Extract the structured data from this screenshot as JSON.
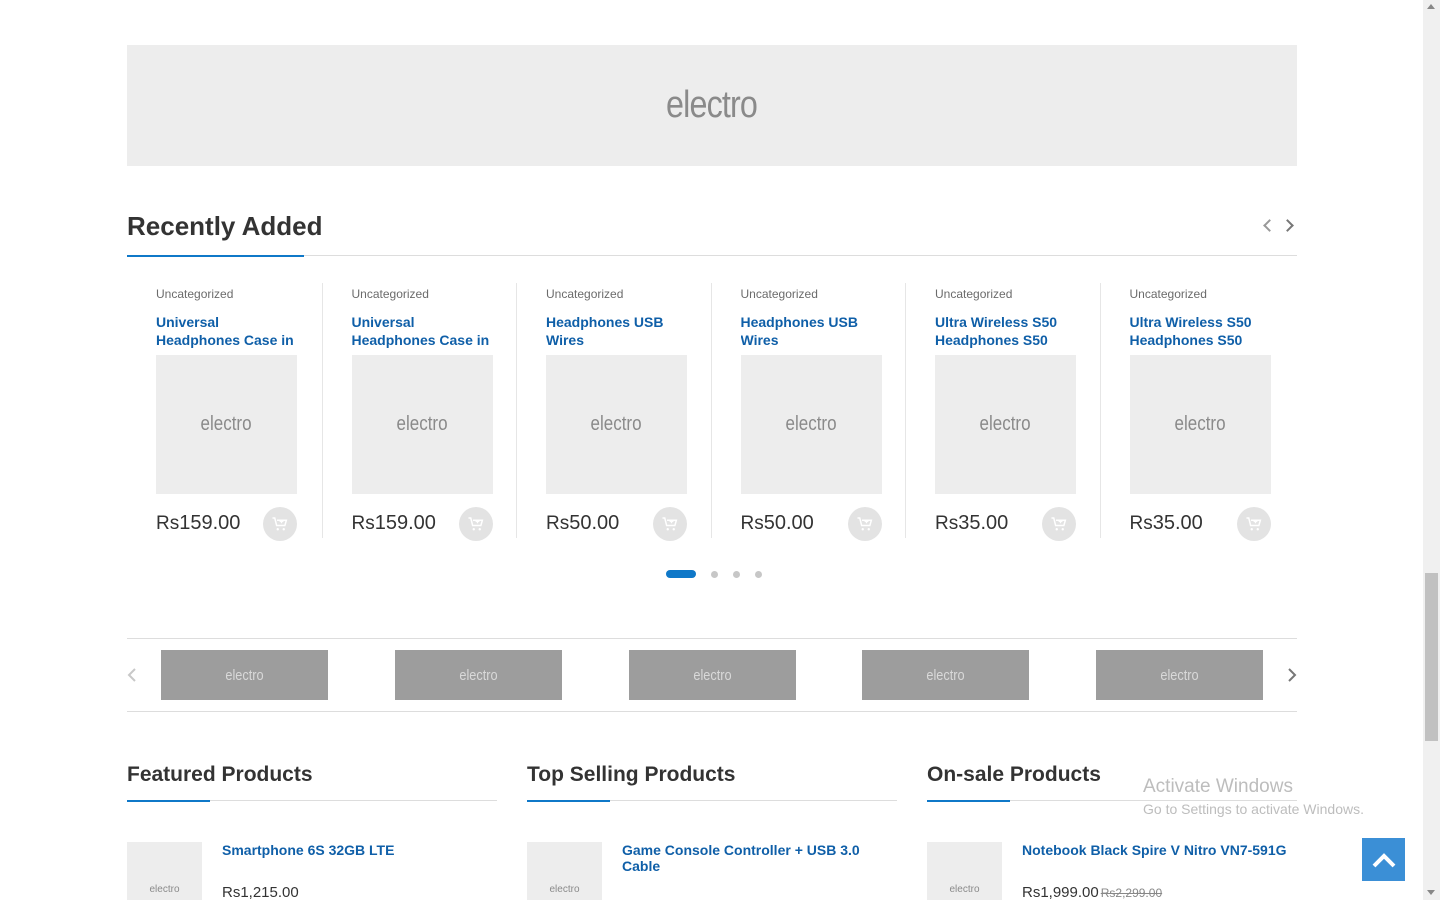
{
  "banner": {
    "logo": "electro"
  },
  "recently_added": {
    "title": "Recently Added",
    "products": [
      {
        "category": "Uncategorized",
        "title": "Universal Headphones Case in",
        "image_text": "electro",
        "currency": "Rs",
        "price": "159.00"
      },
      {
        "category": "Uncategorized",
        "title": "Universal Headphones Case in",
        "image_text": "electro",
        "currency": "Rs",
        "price": "159.00"
      },
      {
        "category": "Uncategorized",
        "title": "Headphones USB Wires",
        "image_text": "electro",
        "currency": "Rs",
        "price": "50.00"
      },
      {
        "category": "Uncategorized",
        "title": "Headphones USB Wires",
        "image_text": "electro",
        "currency": "Rs",
        "price": "50.00"
      },
      {
        "category": "Uncategorized",
        "title": "Ultra Wireless S50 Headphones S50",
        "image_text": "electro",
        "currency": "Rs",
        "price": "35.00"
      },
      {
        "category": "Uncategorized",
        "title": "Ultra Wireless S50 Headphones S50",
        "image_text": "electro",
        "currency": "Rs",
        "price": "35.00"
      }
    ],
    "pagination": {
      "pages": 4,
      "active": 1
    }
  },
  "brands": [
    "electro",
    "electro",
    "electro",
    "electro",
    "electro"
  ],
  "columns": [
    {
      "title": "Featured Products",
      "item": {
        "thumb": "electro",
        "name": "Smartphone 6S 32GB LTE",
        "price": "Rs1,215.00",
        "old_price": ""
      }
    },
    {
      "title": "Top Selling Products",
      "item": {
        "thumb": "electro",
        "name": "Game Console Controller + USB 3.0 Cable",
        "price": "",
        "old_price": ""
      }
    },
    {
      "title": "On-sale Products",
      "item": {
        "thumb": "electro",
        "name": "Notebook Black Spire V Nitro VN7-591G",
        "price": "Rs1,999.00",
        "old_price": "Rs2,299.00"
      }
    }
  ],
  "watermark": {
    "line1": "Activate Windows",
    "line2": "Go to Settings to activate Windows."
  },
  "colors": {
    "accent": "#0f78c8",
    "link": "#0f5fa8",
    "placeholder": "#ededed",
    "brand_bg": "#9d9d9d",
    "to_top": "#3b8fd6"
  },
  "icons": {
    "cart": "add-to-cart-icon",
    "to_top": "chevron-up-icon",
    "prev": "chevron-left-icon",
    "next": "chevron-right-icon"
  }
}
